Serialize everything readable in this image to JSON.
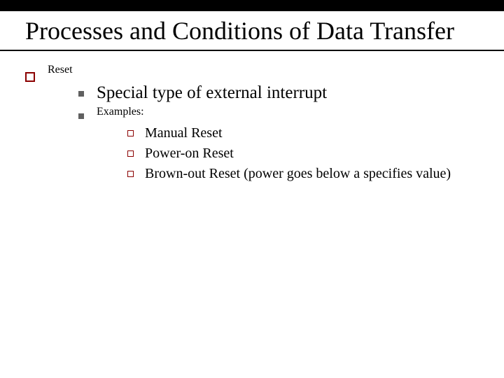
{
  "title": "Processes and Conditions of Data Transfer",
  "lvl1": [
    {
      "label": "Reset",
      "lvl2": [
        {
          "label": "Special type of external interrupt"
        },
        {
          "label": "Examples:",
          "lvl3": [
            {
              "label": "Manual Reset"
            },
            {
              "label": "Power-on Reset"
            },
            {
              "label": "Brown-out Reset (power goes below a specifies value)"
            }
          ]
        }
      ]
    }
  ]
}
